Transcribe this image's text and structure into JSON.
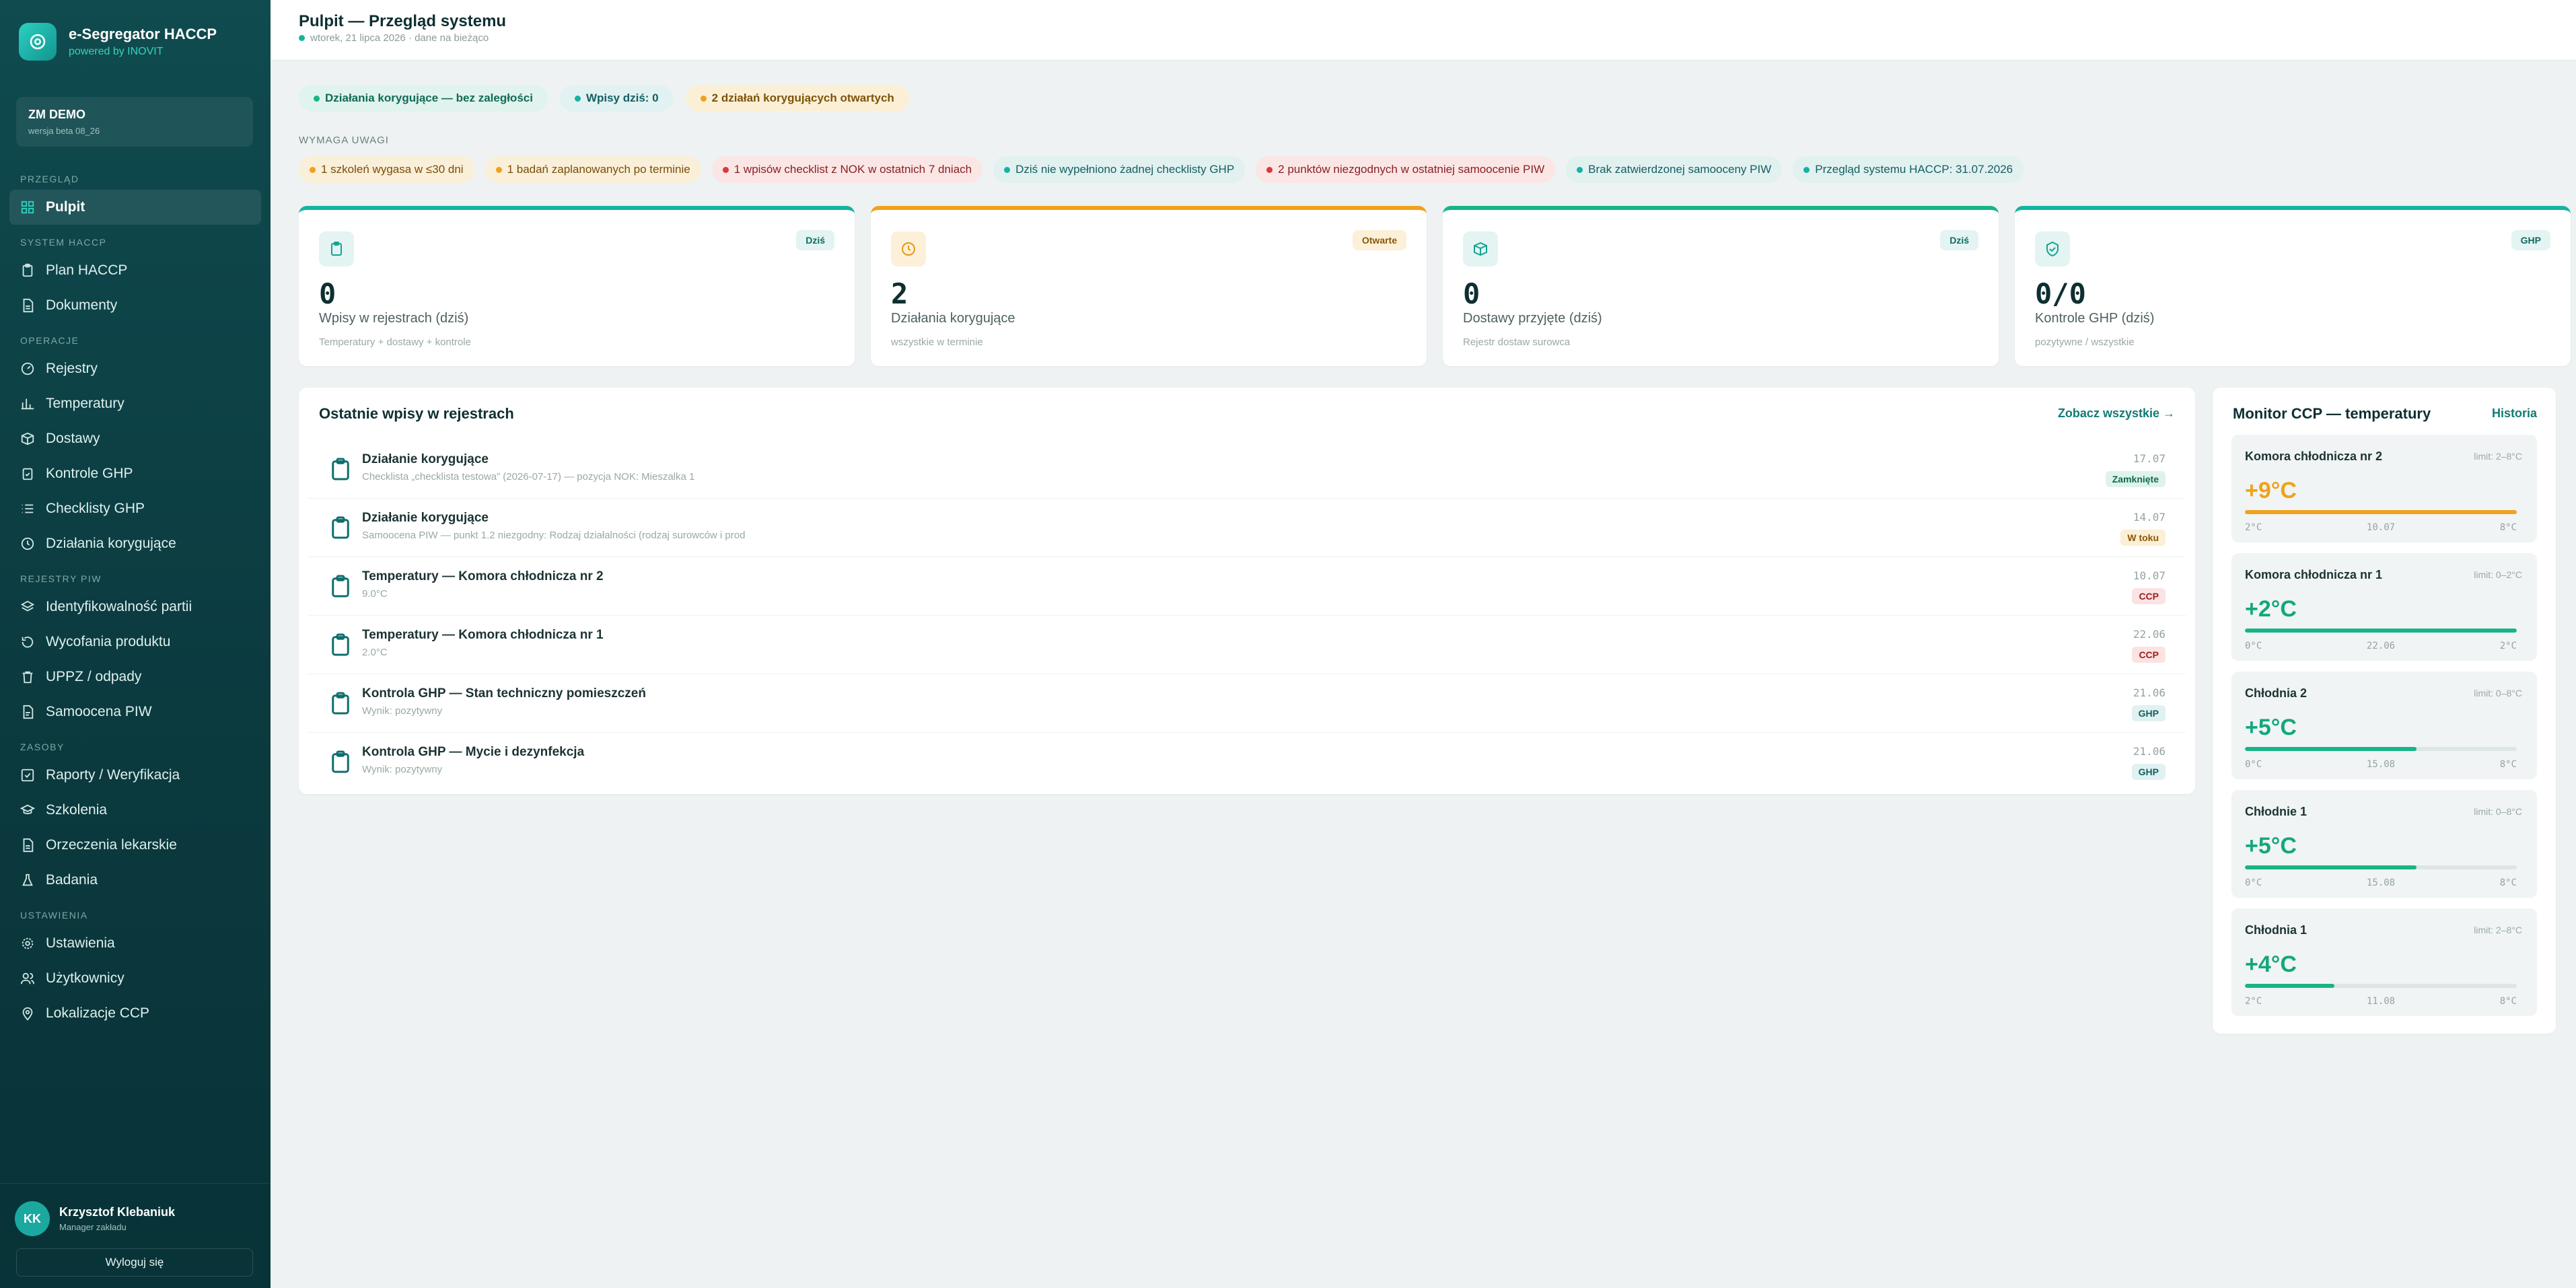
{
  "brand": {
    "title": "e-Segregator HACCP",
    "subtitle": "powered by INOVIT"
  },
  "plant": {
    "name": "ZM DEMO",
    "version": "wersja beta 08_26"
  },
  "nav": {
    "sec_przeglad": "PRZEGLĄD",
    "pulpit": "Pulpit",
    "sec_system": "SYSTEM HACCP",
    "plan_haccp": "Plan HACCP",
    "dokumenty": "Dokumenty",
    "sec_operacje": "OPERACJE",
    "rejestry": "Rejestry",
    "temperatury": "Temperatury",
    "dostawy": "Dostawy",
    "kontrole_ghp": "Kontrole GHP",
    "checklisty_ghp": "Checklisty GHP",
    "dzialania": "Działania korygujące",
    "sec_piw": "REJESTRY PIW",
    "identyfikowalnosc": "Identyfikowalność partii",
    "wycofania": "Wycofania produktu",
    "uppz": "UPPZ / odpady",
    "samoocena": "Samoocena PIW",
    "sec_zasoby": "ZASOBY",
    "raporty": "Raporty / Weryfikacja",
    "szkolenia": "Szkolenia",
    "orzeczenia": "Orzeczenia lekarskie",
    "badania": "Badania",
    "sec_ustawienia": "USTAWIENIA",
    "ustawienia": "Ustawienia",
    "uzytkownicy": "Użytkownicy",
    "lokalizacje": "Lokalizacje CCP"
  },
  "user": {
    "initials": "KK",
    "name": "Krzysztof Klebaniuk",
    "role": "Manager zakładu",
    "logout": "Wyloguj się"
  },
  "header": {
    "title": "Pulpit — Przegląd systemu",
    "subtitle": "wtorek, 21 lipca 2026 · dane na bieżąco"
  },
  "status": [
    "Działania korygujące — bez zaległości",
    "Wpisy dziś: 0",
    "2 działań korygujących otwartych"
  ],
  "attention": {
    "title": "WYMAGA UWAGI",
    "items": [
      "1 szkoleń wygasa w ≤30 dni",
      "1 badań zaplanowanych po terminie",
      "1 wpisów checklist z NOK w ostatnich 7 dniach",
      "Dziś nie wypełniono żadnej checklisty GHP",
      "2 punktów niezgodnych w ostatniej samoocenie PIW",
      "Brak zatwierdzonej samooceny PIW",
      "Przegląd systemu HACCP: 31.07.2026"
    ]
  },
  "kpis": [
    {
      "badge": "Dziś",
      "value": "0",
      "label": "Wpisy w rejestrach (dziś)",
      "note": "Temperatury + dostawy + kontrole"
    },
    {
      "badge": "Otwarte",
      "value": "2",
      "label": "Działania korygujące",
      "note": "wszystkie w terminie"
    },
    {
      "badge": "Dziś",
      "value": "0",
      "label": "Dostawy przyjęte (dziś)",
      "note": "Rejestr dostaw surowca"
    },
    {
      "badge": "GHP",
      "value": "0/0",
      "label": "Kontrole GHP (dziś)",
      "note": "pozytywne / wszystkie"
    }
  ],
  "entries": {
    "title": "Ostatnie wpisy w rejestrach",
    "link": "Zobacz wszystkie →",
    "items": [
      {
        "title": "Działanie korygujące",
        "sub": "Checklista „checklista testowa” (2026-07-17) — pozycja NOK: Mieszalka 1",
        "date": "17.07",
        "tag": "Zamknięte"
      },
      {
        "title": "Działanie korygujące",
        "sub": "Samoocena PIW — punkt 1.2 niezgodny: Rodzaj działalności (rodzaj surowców i prod",
        "date": "14.07",
        "tag": "W toku"
      },
      {
        "title": "Temperatury — Komora chłodnicza nr 2",
        "sub": "9.0°C",
        "date": "10.07",
        "tag": "CCP"
      },
      {
        "title": "Temperatury — Komora chłodnicza nr 1",
        "sub": "2.0°C",
        "date": "22.06",
        "tag": "CCP"
      },
      {
        "title": "Kontrola GHP — Stan techniczny pomieszczeń",
        "sub": "Wynik: pozytywny",
        "date": "21.06",
        "tag": "GHP"
      },
      {
        "title": "Kontrola GHP — Mycie i dezynfekcja",
        "sub": "Wynik: pozytywny",
        "date": "21.06",
        "tag": "GHP"
      }
    ]
  },
  "monitor": {
    "title": "Monitor CCP — temperatury",
    "link": "Historia",
    "sensors": [
      {
        "name": "Komora chłodnicza nr 2",
        "limit": "limit: 2–8°C",
        "value": "+9°C",
        "level": 1.0,
        "min": "2°C",
        "date": "10.07",
        "max": "8°C",
        "status": "warn"
      },
      {
        "name": "Komora chłodnicza nr 1",
        "limit": "limit: 0–2°C",
        "value": "+2°C",
        "level": 1.0,
        "min": "0°C",
        "date": "22.06",
        "max": "2°C",
        "status": "ok"
      },
      {
        "name": "Chłodnia 2",
        "limit": "limit: 0–8°C",
        "value": "+5°C",
        "level": 0.63,
        "min": "0°C",
        "date": "15.08",
        "max": "8°C",
        "status": "ok"
      },
      {
        "name": "Chłodnie 1",
        "limit": "limit: 0–8°C",
        "value": "+5°C",
        "level": 0.63,
        "min": "0°C",
        "date": "15.08",
        "max": "8°C",
        "status": "ok"
      },
      {
        "name": "Chłodnia 1",
        "limit": "limit: 2–8°C",
        "value": "+4°C",
        "level": 0.33,
        "min": "2°C",
        "date": "11.08",
        "max": "8°C",
        "status": "ok"
      }
    ]
  },
  "colors": {
    "accent": "#14b3a2",
    "warn": "#f0a21a",
    "ok": "#17b487",
    "danger": "#d83a3a",
    "sidebar": "#0b3a3f"
  }
}
